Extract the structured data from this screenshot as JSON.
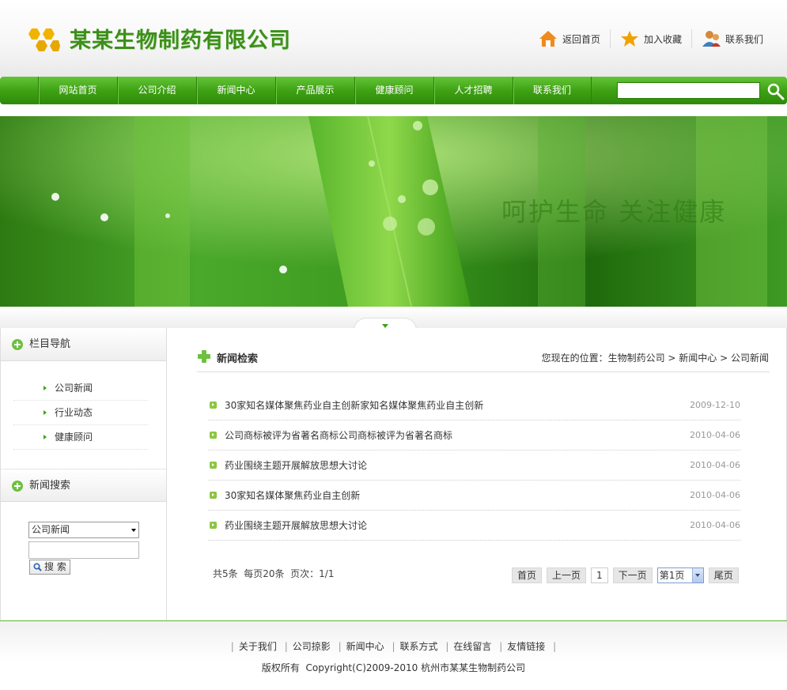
{
  "brand": {
    "company_name": "某某生物制药有限公司",
    "accent_green": "#3fa214"
  },
  "top_links": [
    {
      "label": "返回首页",
      "icon": "home-icon"
    },
    {
      "label": "加入收藏",
      "icon": "star-icon"
    },
    {
      "label": "联系我们",
      "icon": "contact-icon"
    }
  ],
  "nav": {
    "items": [
      "网站首页",
      "公司介绍",
      "新闻中心",
      "产品展示",
      "健康顾问",
      "人才招聘",
      "联系我们"
    ],
    "search_value": ""
  },
  "banner": {
    "slogan": "呵护生命 关注健康"
  },
  "sidebar": {
    "nav_title": "栏目导航",
    "nav_items": [
      "公司新闻",
      "行业动态",
      "健康顾问"
    ],
    "search_title": "新闻搜索",
    "search_category": "公司新闻",
    "search_keyword": "",
    "search_button": "搜 索"
  },
  "main": {
    "title": "新闻检索",
    "breadcrumb": {
      "prefix": "您现在的位置：",
      "items": [
        "生物制药公司",
        "新闻中心",
        "公司新闻"
      ]
    },
    "news": [
      {
        "title": "30家知名媒体聚焦药业自主创新家知名媒体聚焦药业自主创新",
        "date": "2009-12-10"
      },
      {
        "title": "公司商标被评为省著名商标公司商标被评为省著名商标",
        "date": "2010-04-06"
      },
      {
        "title": "药业围绕主题开展解放思想大讨论",
        "date": "2010-04-06"
      },
      {
        "title": "30家知名媒体聚焦药业自主创新",
        "date": "2010-04-06"
      },
      {
        "title": "药业围绕主题开展解放思想大讨论",
        "date": "2010-04-06"
      }
    ],
    "page_info": "共5条  每页20条  页次：1/1",
    "pager": {
      "first": "首页",
      "prev": "上一页",
      "current": "1",
      "next": "下一页",
      "page_select": "第1页",
      "last": "尾页"
    }
  },
  "footer": {
    "links": [
      "关于我们",
      "公司掠影",
      "新闻中心",
      "联系方式",
      "在线留言",
      "友情链接"
    ],
    "copyright": "版权所有  Copyright(C)2009-2010 杭州市某某生物制药公司"
  }
}
